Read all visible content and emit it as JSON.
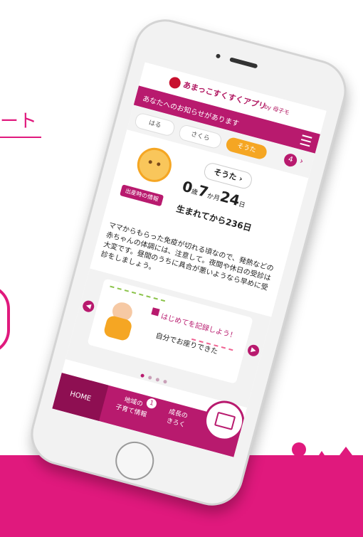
{
  "background": {
    "heading_fragment": "ート",
    "accent_color": "#e0197d"
  },
  "app": {
    "logo_icon": "apple-girl-logo-icon",
    "name": "あまっこすくすくアプリ",
    "by": "by 母子モ",
    "brand_color": "#b81a6e"
  },
  "notice_bar": {
    "text": "あなたへのお知らせがあります",
    "menu_icon": "hamburger-menu-icon"
  },
  "child_tabs": {
    "items": [
      "はる",
      "さくら",
      "そうた"
    ],
    "selected": "そうた",
    "count_badge": "4",
    "next_icon": "chevron-right-icon"
  },
  "profile": {
    "name": "そうた",
    "birth_info_button": "出産時の情報",
    "age_years": "0",
    "age_years_unit": "歳",
    "age_months": "7",
    "age_months_unit": "か月",
    "age_days": "24",
    "age_days_unit": "日",
    "days_since_birth": "生まれてから236日"
  },
  "advice": {
    "text": "ママからもらった免疫が切れる頃なので、発熱などの赤ちゃんの体調には、注意して。夜間や休日の受診は大変です。昼間のうちに具合が悪いようなら早めに受診をしましょう。"
  },
  "carousel": {
    "card_title": "はじめてを記録しよう！",
    "card_subtitle": "自分でお座りできた",
    "prev_icon": "chevron-left-icon",
    "next_icon": "chevron-right-icon",
    "page_count": 4,
    "active_page": 1
  },
  "bottom_nav": {
    "home": "HOME",
    "local_info_line1": "地域の",
    "local_info_line2": "子育て情報",
    "local_info_badge": "1",
    "growth_line1": "成長の",
    "growth_line2": "きろく",
    "fab_icon": "diary-pen-icon"
  }
}
